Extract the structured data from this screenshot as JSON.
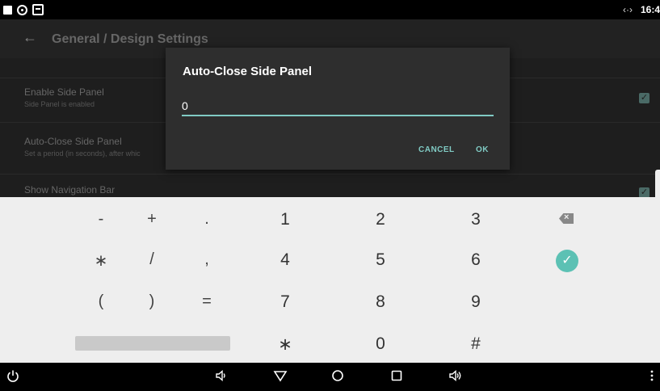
{
  "status_bar": {
    "time": "16:4",
    "network_glyph": "‹·›"
  },
  "toolbar": {
    "title": "General / Design Settings",
    "back_icon": "arrow-left-icon"
  },
  "prefs": [
    {
      "title": "Enable Side Panel",
      "summary": "Side Panel is enabled",
      "checked": true
    },
    {
      "title": "Auto-Close Side Panel",
      "summary": "Set a period (in seconds), after whic"
    },
    {
      "title": "Show Navigation Bar",
      "checked": true
    }
  ],
  "dialog": {
    "title": "Auto-Close Side Panel",
    "input_value": "0",
    "cancel_label": "CANCEL",
    "ok_label": "OK"
  },
  "keyboard": {
    "rows": [
      [
        "-",
        "+",
        ".",
        "1",
        "2",
        "3"
      ],
      [
        "∗",
        "/",
        ",",
        "4",
        "5",
        "6"
      ],
      [
        "(",
        ")",
        "=",
        "7",
        "8",
        "9"
      ],
      [
        "∗",
        "0",
        "#"
      ]
    ],
    "accent": "#5cc1b4"
  },
  "colors": {
    "accent": "#80cbc4",
    "dialog_bg": "#2e2e2e"
  }
}
